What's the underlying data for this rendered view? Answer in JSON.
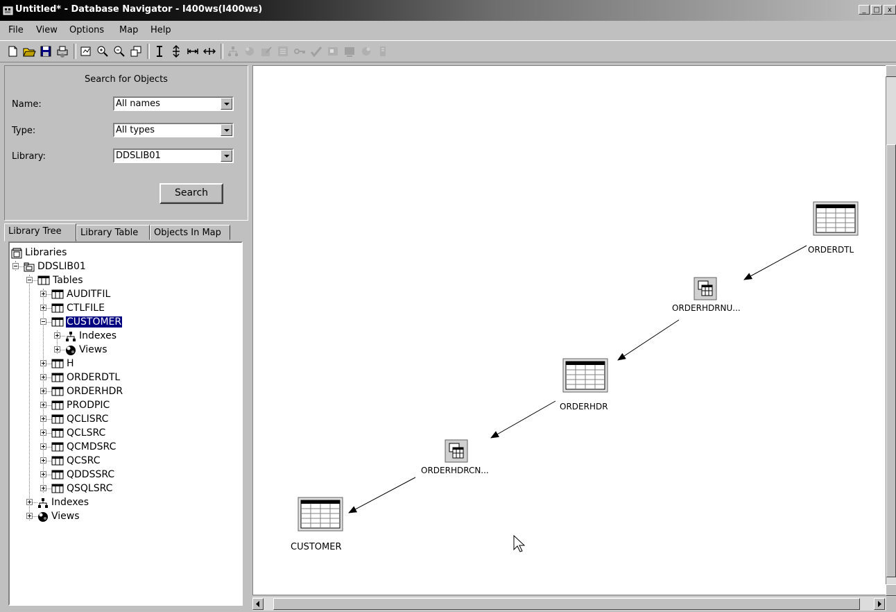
{
  "window": {
    "title": "Untitled* - Database Navigator - I400ws(I400ws)"
  },
  "menu": [
    "File",
    "View",
    "Options",
    "Map",
    "Help"
  ],
  "search": {
    "heading": "Search for Objects",
    "name_label": "Name:",
    "name_value": "All names",
    "type_label": "Type:",
    "type_value": "All types",
    "library_label": "Library:",
    "library_value": "DDSLIB01",
    "button": "Search"
  },
  "tabs": [
    "Library Tree",
    "Library Table",
    "Objects In Map"
  ],
  "tree": {
    "root": "Libraries",
    "library": "DDSLIB01",
    "tables": "Tables",
    "items": {
      "auditfil": "AUDITFIL",
      "ctlfile": "CTLFILE",
      "customer": "CUSTOMER",
      "customer_indexes": "Indexes",
      "customer_views": "Views",
      "h": "H",
      "orderdtl": "ORDERDTL",
      "orderhdr": "ORDERHDR",
      "prodpic": "PRODPIC",
      "qclisrc": "QCLISRC",
      "qclsrc": "QCLSRC",
      "qcmdsrc": "QCMDSRC",
      "qcsrc": "QCSRC",
      "qddssrc": "QDDSSRC",
      "qsqlsrc": "QSQLSRC"
    },
    "lib_indexes": "Indexes",
    "lib_views": "Views"
  },
  "map": {
    "nodes": {
      "orderdtl": "ORDERDTL",
      "orderhdrnu": "ORDERHDRNU...",
      "orderhdr": "ORDERHDR",
      "orderhdrcn": "ORDERHDRCN...",
      "customer": "CUSTOMER"
    }
  }
}
